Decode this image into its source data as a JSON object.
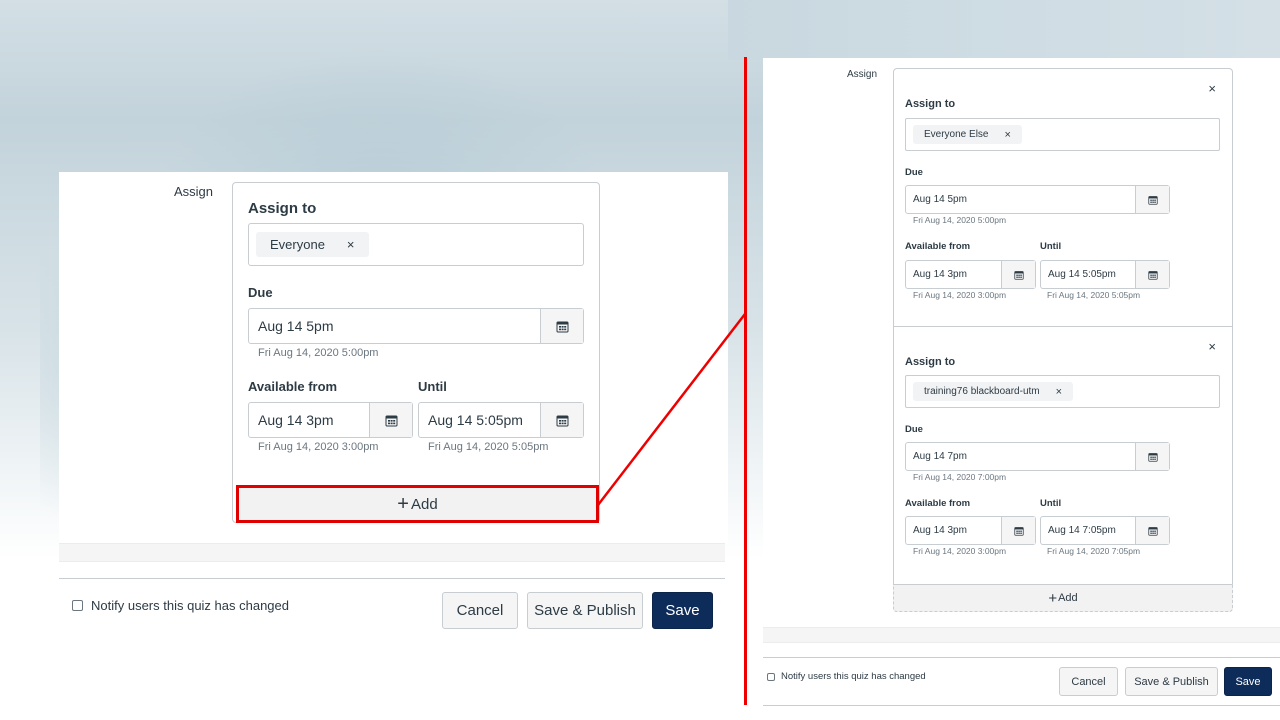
{
  "left_panel": {
    "assign_label": "Assign",
    "card": {
      "assign_to_label": "Assign to",
      "assignee_chip": "Everyone",
      "due_label": "Due",
      "due_value": "Aug 14 5pm",
      "due_hint": "Fri Aug 14, 2020 5:00pm",
      "available_from_label": "Available from",
      "available_from_value": "Aug 14 3pm",
      "available_from_hint": "Fri Aug 14, 2020 3:00pm",
      "until_label": "Until",
      "until_value": "Aug 14 5:05pm",
      "until_hint": "Fri Aug 14, 2020 5:05pm"
    },
    "add_button": {
      "icon": "+",
      "label": "Add"
    },
    "footer": {
      "notify_label": "Notify users this quiz has changed",
      "notify_checked": false,
      "cancel_label": "Cancel",
      "save_publish_label": "Save & Publish",
      "save_label": "Save"
    }
  },
  "right_panel": {
    "assign_label": "Assign",
    "sections": [
      {
        "assign_to_label": "Assign to",
        "assignee_chip": "Everyone Else",
        "due_label": "Due",
        "due_value": "Aug 14 5pm",
        "due_hint": "Fri Aug 14, 2020 5:00pm",
        "available_from_label": "Available from",
        "available_from_value": "Aug 14 3pm",
        "available_from_hint": "Fri Aug 14, 2020 3:00pm",
        "until_label": "Until",
        "until_value": "Aug 14 5:05pm",
        "until_hint": "Fri Aug 14, 2020 5:05pm"
      },
      {
        "assign_to_label": "Assign to",
        "assignee_chip": "training76 blackboard-utm",
        "due_label": "Due",
        "due_value": "Aug 14 7pm",
        "due_hint": "Fri Aug 14, 2020 7:00pm",
        "available_from_label": "Available from",
        "available_from_value": "Aug 14 3pm",
        "available_from_hint": "Fri Aug 14, 2020 3:00pm",
        "until_label": "Until",
        "until_value": "Aug 14 7:05pm",
        "until_hint": "Fri Aug 14, 2020 7:05pm"
      }
    ],
    "add_button": {
      "icon": "+",
      "label": "Add"
    },
    "footer": {
      "notify_label": "Notify users this quiz has changed",
      "notify_checked": false,
      "cancel_label": "Cancel",
      "save_publish_label": "Save & Publish",
      "save_label": "Save"
    }
  },
  "icons": {
    "remove_chip": "×",
    "close_section": "×",
    "calendar": "calendar-icon"
  },
  "colors": {
    "primary_button": "#0e2c5a",
    "highlight": "#ee0000",
    "text": "#2d3b45",
    "hint_text": "#6b7780",
    "border": "#c7cdd1"
  }
}
